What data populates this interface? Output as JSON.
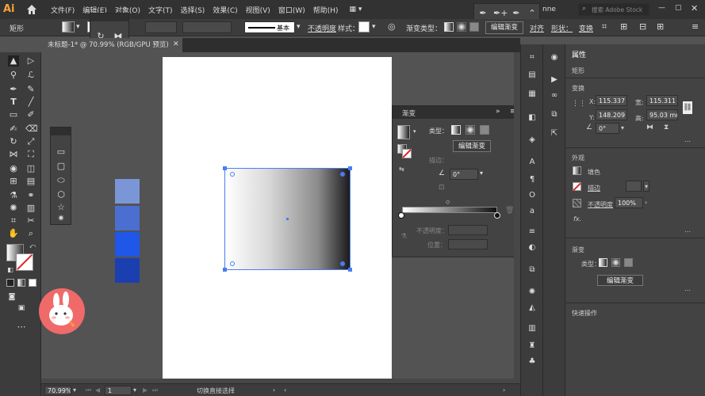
{
  "app": {
    "logo": "Ai"
  },
  "menubar": {
    "items": [
      "文件(F)",
      "编辑(E)",
      "对象(O)",
      "文字(T)",
      "选择(S)",
      "效果(C)",
      "视图(V)",
      "窗口(W)",
      "帮助(H)"
    ],
    "user_fragment": "nne",
    "search_placeholder": "搜索 Adobe Stock"
  },
  "controlbar": {
    "object_type": "矩形",
    "stroke_style": "基本",
    "opacity_label": "不透明度",
    "style_label": "样式：",
    "gradient_type_label": "渐变类型：",
    "edit_gradient": "编辑渐变",
    "align": "对齐",
    "shape": "形状：",
    "transform": "变换"
  },
  "document": {
    "tab_title": "未标题-1* @ 70.99% (RGB/GPU 预览)",
    "zoom": "70.99%",
    "artboard_number": "1",
    "status_text": "切换直接选择"
  },
  "gradient_panel": {
    "title": "渐变",
    "type_label": "类型：",
    "edit_button": "编辑渐变",
    "stroke_label": "描边：",
    "angle": "0°",
    "opacity_label": "不透明度：",
    "location_label": "位置："
  },
  "swatches": [
    "#7b96d6",
    "#4a6fd0",
    "#1f57e8",
    "#1b3fb0"
  ],
  "properties": {
    "tab": "属性",
    "object_type": "矩形",
    "transform_title": "变换",
    "x_label": "X:",
    "x": "115.337",
    "width_label": "宽:",
    "width": "115.311",
    "y_label": "Y:",
    "y": "148.209",
    "height_label": "高:",
    "height": "95.03 mm",
    "rotation": "0°",
    "appearance_title": "外观",
    "fill_label": "填色",
    "stroke_label": "描边",
    "opacity_label": "不透明度",
    "opacity": "100%",
    "fx": "fx.",
    "gradient_title": "渐变",
    "gradient_type_label": "类型：",
    "edit_gradient": "编辑渐变",
    "quick_actions": "快速操作"
  }
}
